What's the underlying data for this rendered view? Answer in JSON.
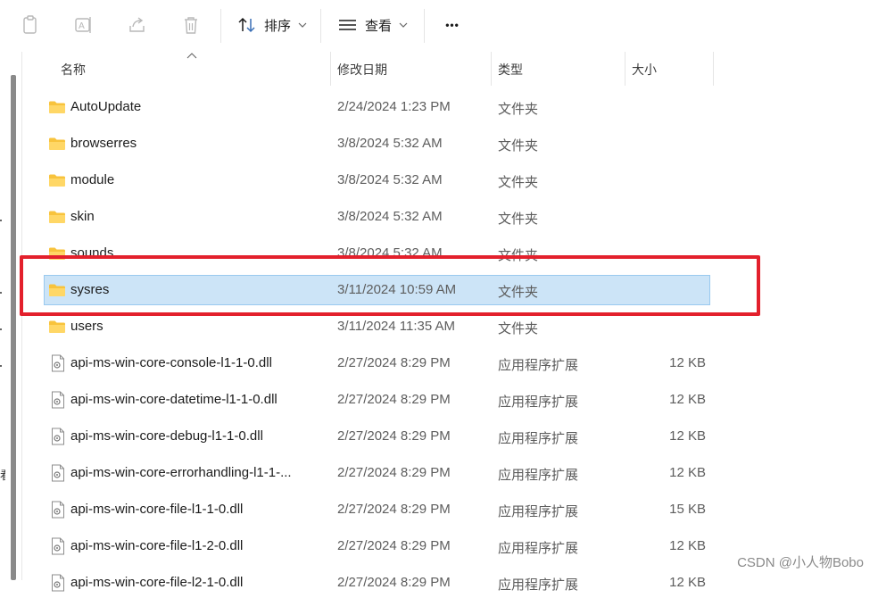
{
  "toolbar": {
    "icons": [
      "copy-icon",
      "rename-icon",
      "share-icon",
      "delete-icon"
    ],
    "sort_label": "排序",
    "view_label": "查看",
    "more_label": "•••"
  },
  "left_fragment": "看",
  "columns": {
    "name": "名称",
    "date": "修改日期",
    "type": "类型",
    "size": "大小"
  },
  "files": [
    {
      "name": "AutoUpdate",
      "date": "2/24/2024 1:23 PM",
      "type": "文件夹",
      "size": "",
      "kind": "folder"
    },
    {
      "name": "browserres",
      "date": "3/8/2024 5:32 AM",
      "type": "文件夹",
      "size": "",
      "kind": "folder"
    },
    {
      "name": "module",
      "date": "3/8/2024 5:32 AM",
      "type": "文件夹",
      "size": "",
      "kind": "folder"
    },
    {
      "name": "skin",
      "date": "3/8/2024 5:32 AM",
      "type": "文件夹",
      "size": "",
      "kind": "folder"
    },
    {
      "name": "sounds",
      "date": "3/8/2024 5:32 AM",
      "type": "文件夹",
      "size": "",
      "kind": "folder"
    },
    {
      "name": "sysres",
      "date": "3/11/2024 10:59 AM",
      "type": "文件夹",
      "size": "",
      "kind": "folder",
      "selected": true
    },
    {
      "name": "users",
      "date": "3/11/2024 11:35 AM",
      "type": "文件夹",
      "size": "",
      "kind": "folder"
    },
    {
      "name": "api-ms-win-core-console-l1-1-0.dll",
      "date": "2/27/2024 8:29 PM",
      "type": "应用程序扩展",
      "size": "12 KB",
      "kind": "dll"
    },
    {
      "name": "api-ms-win-core-datetime-l1-1-0.dll",
      "date": "2/27/2024 8:29 PM",
      "type": "应用程序扩展",
      "size": "12 KB",
      "kind": "dll"
    },
    {
      "name": "api-ms-win-core-debug-l1-1-0.dll",
      "date": "2/27/2024 8:29 PM",
      "type": "应用程序扩展",
      "size": "12 KB",
      "kind": "dll"
    },
    {
      "name": "api-ms-win-core-errorhandling-l1-1-...",
      "date": "2/27/2024 8:29 PM",
      "type": "应用程序扩展",
      "size": "12 KB",
      "kind": "dll"
    },
    {
      "name": "api-ms-win-core-file-l1-1-0.dll",
      "date": "2/27/2024 8:29 PM",
      "type": "应用程序扩展",
      "size": "15 KB",
      "kind": "dll"
    },
    {
      "name": "api-ms-win-core-file-l1-2-0.dll",
      "date": "2/27/2024 8:29 PM",
      "type": "应用程序扩展",
      "size": "12 KB",
      "kind": "dll"
    },
    {
      "name": "api-ms-win-core-file-l2-1-0.dll",
      "date": "2/27/2024 8:29 PM",
      "type": "应用程序扩展",
      "size": "12 KB",
      "kind": "dll"
    }
  ],
  "watermark": "CSDN @小人物Bobo",
  "colors": {
    "selection_bg": "#cce4f7",
    "selection_border": "#99c9ef",
    "annotation_red": "#e3202c",
    "folder_yellow": "#f8c33c"
  }
}
